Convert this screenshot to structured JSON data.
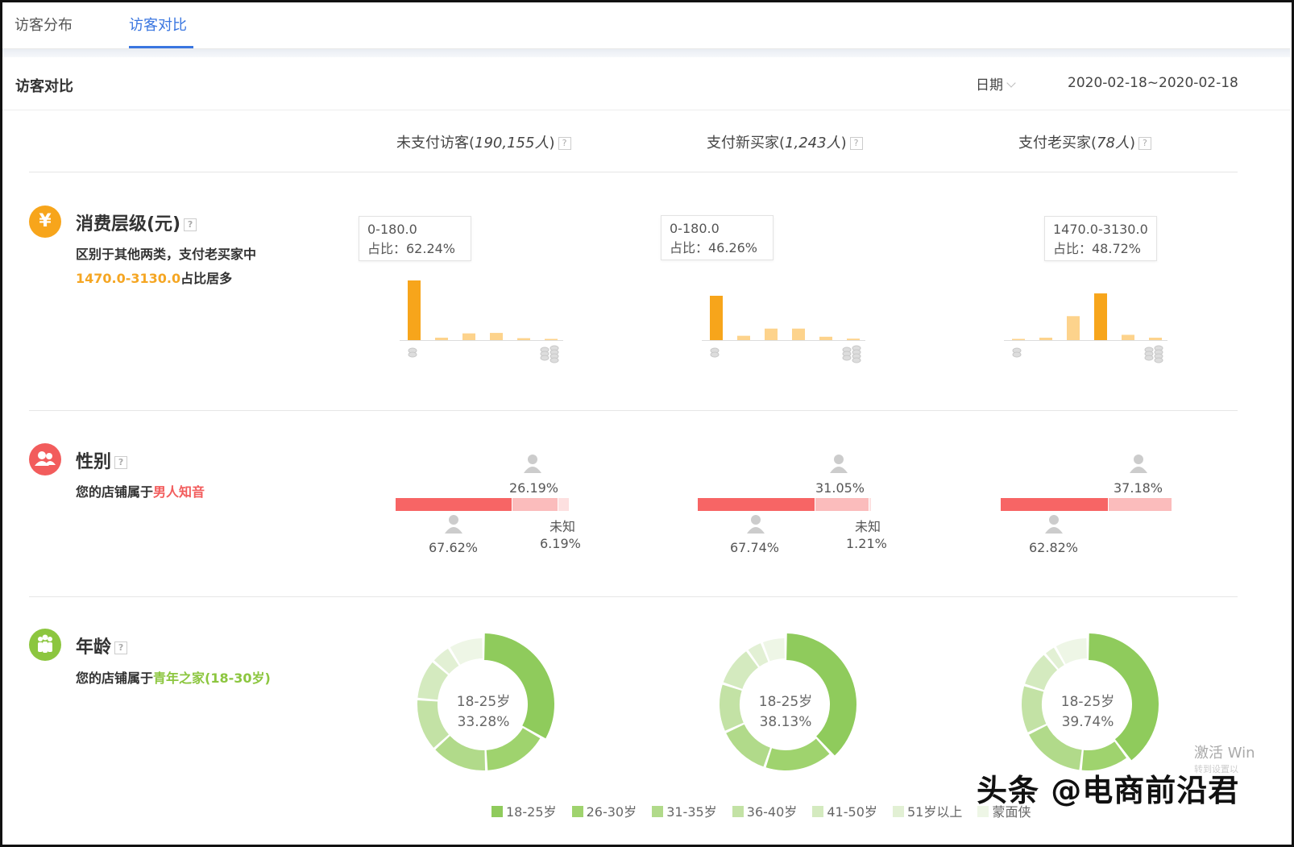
{
  "tabs": [
    {
      "label": "访客分布",
      "active": false
    },
    {
      "label": "访客对比",
      "active": true
    }
  ],
  "section": {
    "title": "访客对比",
    "date_label": "日期",
    "date_range": "2020-02-18~2020-02-18"
  },
  "columns": [
    {
      "name": "未支付访客",
      "count": "190,155人"
    },
    {
      "name": "支付新买家",
      "count": "1,243人"
    },
    {
      "name": "支付老买家",
      "count": "78人"
    }
  ],
  "help_mark": "?",
  "spend": {
    "title": "消费层级(元)",
    "icon": "yen-icon",
    "desc1": "区别于其他两类，支付老买家中",
    "desc_highlight": "1470.0-3130.0",
    "desc2": "占比居多",
    "colors": {
      "highlight": "#f7a51b",
      "normal": "#fdd38c"
    },
    "tooltips": [
      {
        "range": "0-180.0",
        "ratio": "占比：62.24%"
      },
      {
        "range": "0-180.0",
        "ratio": "占比：46.26%"
      },
      {
        "range": "1470.0-3130.0",
        "ratio": "占比：48.72%"
      }
    ]
  },
  "gender": {
    "title": "性别",
    "icon": "gender-icon",
    "desc1": "您的店铺属于",
    "desc_highlight": "男人知音",
    "unknown_label": "未知",
    "colors": {
      "male": "#f76565",
      "female": "#fbbcbc",
      "unknown": "#fde0e0"
    },
    "columns": [
      {
        "female": "26.19%",
        "male": "67.62%",
        "unknown": "6.19%"
      },
      {
        "female": "31.05%",
        "male": "67.74%",
        "unknown": "1.21%"
      },
      {
        "female": "37.18%",
        "male": "62.82%",
        "unknown": ""
      }
    ]
  },
  "age": {
    "title": "年龄",
    "icon": "age-group-icon",
    "desc1": "您的店铺属于",
    "desc_highlight": "青年之家(18-30岁)",
    "legend": [
      {
        "label": "18-25岁",
        "color": "#8fcb5c"
      },
      {
        "label": "26-30岁",
        "color": "#9fd36e"
      },
      {
        "label": "31-35岁",
        "color": "#b1da8a"
      },
      {
        "label": "36-40岁",
        "color": "#c3e2a5"
      },
      {
        "label": "41-50岁",
        "color": "#d4eabf"
      },
      {
        "label": "51岁以上",
        "color": "#e2f0d4"
      },
      {
        "label": "蒙面侠",
        "color": "#eef6e6"
      }
    ],
    "columns": [
      {
        "center_label": "18-25岁",
        "center_value": "33.28%"
      },
      {
        "center_label": "18-25岁",
        "center_value": "38.13%"
      },
      {
        "center_label": "18-25岁",
        "center_value": "39.74%"
      }
    ]
  },
  "chart_data": [
    {
      "type": "bar",
      "title": "",
      "values": [
        62.24,
        2.5,
        7.0,
        7.5,
        2.0,
        1.0
      ],
      "highlight_index": 0
    },
    {
      "type": "bar",
      "title": "",
      "values": [
        46.26,
        4.5,
        12.0,
        12.0,
        3.5,
        1.5
      ],
      "highlight_index": 0
    },
    {
      "type": "bar",
      "title": "",
      "values": [
        0.8,
        2.5,
        25.0,
        48.72,
        5.5,
        2.5
      ],
      "highlight_index": 3
    },
    {
      "type": "pie",
      "title": "",
      "categories": [
        "18-25岁",
        "26-30岁",
        "31-35岁",
        "36-40岁",
        "41-50岁",
        "51岁以上",
        "蒙面侠"
      ],
      "values": [
        33.28,
        16,
        14,
        13,
        10,
        5,
        8.72
      ]
    },
    {
      "type": "pie",
      "title": "",
      "categories": [
        "18-25岁",
        "26-30岁",
        "31-35岁",
        "36-40岁",
        "41-50岁",
        "51岁以上",
        "蒙面侠"
      ],
      "values": [
        38.13,
        17,
        13,
        12,
        10,
        4,
        5.87
      ]
    },
    {
      "type": "pie",
      "title": "",
      "categories": [
        "18-25岁",
        "26-30岁",
        "31-35岁",
        "36-40岁",
        "41-50岁",
        "51岁以上",
        "蒙面侠"
      ],
      "values": [
        39.74,
        12,
        16,
        12,
        9,
        3,
        8.26
      ]
    }
  ],
  "watermark": "头条 @电商前沿君",
  "windows_activation": "激活 Win",
  "windows_activation_sub": "转到设置以"
}
